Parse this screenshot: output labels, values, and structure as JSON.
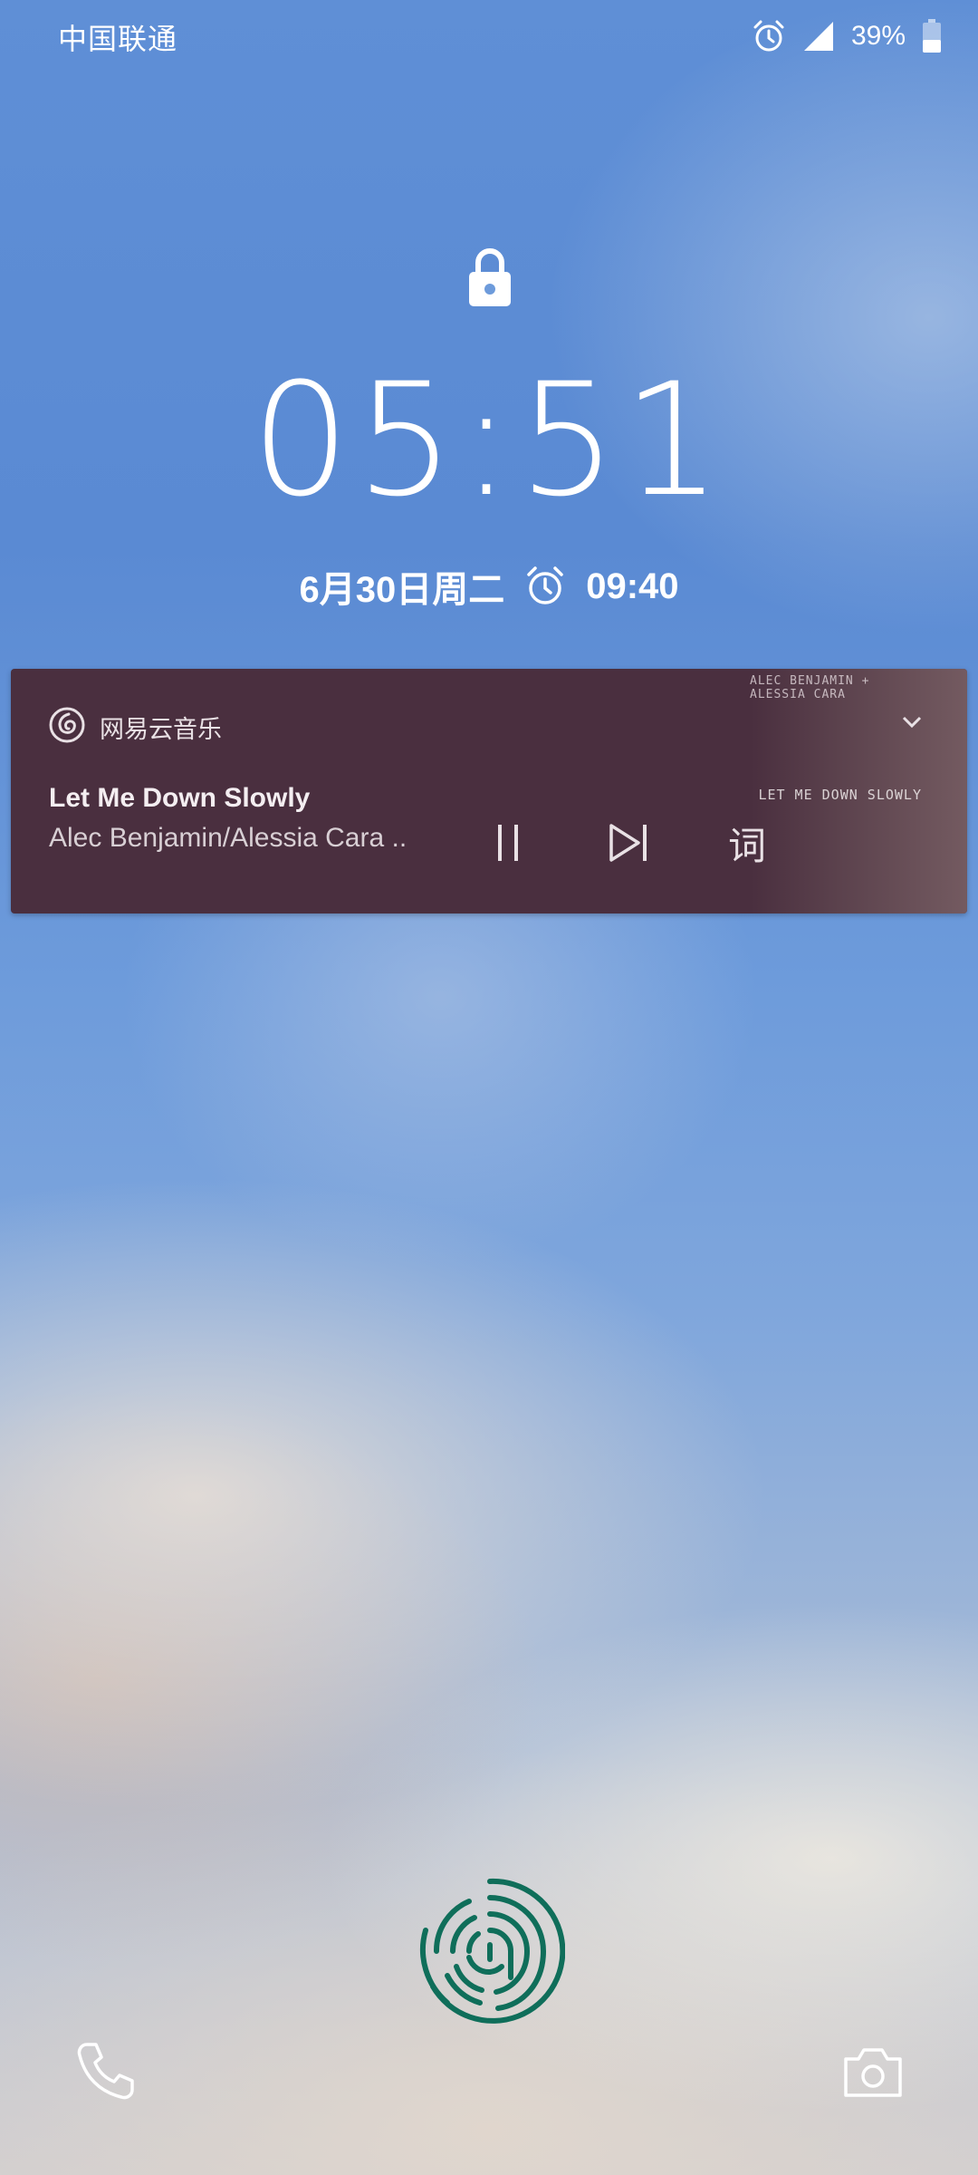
{
  "status_bar": {
    "carrier": "中国联通",
    "battery_percent": "39%",
    "icons": [
      "alarm-icon",
      "signal-icon",
      "battery-icon"
    ]
  },
  "lockscreen": {
    "time": "05:51",
    "date": "6月30日周二",
    "alarm_time": "09:40"
  },
  "notification": {
    "app_name": "网易云音乐",
    "song_title": "Let Me Down Slowly",
    "artist": "Alec Benjamin/Alessia Cara ..",
    "album_art_caption": "LET ME DOWN SLOWLY",
    "album_art_header": "ALEC BENJAMIN + ALESSIA CARA",
    "lyrics_button": "词",
    "background_color": "#4a2f3f"
  },
  "fingerprint": {
    "icon": "fingerprint-icon",
    "color": "#0f6e5a"
  },
  "shortcuts": {
    "left": "phone-icon",
    "right": "camera-icon"
  }
}
